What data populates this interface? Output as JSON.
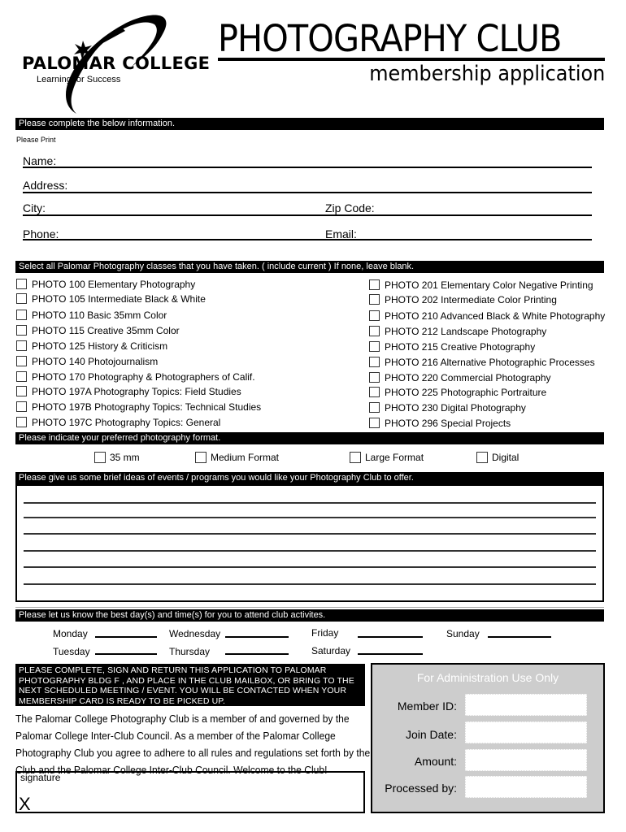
{
  "header": {
    "logo_name": "PALOMAR COLLEGE",
    "logo_tagline": "Learning for Success",
    "title": "PHOTOGRAPHY CLUB",
    "subtitle": "membership application"
  },
  "info_section": {
    "banner": "Please complete the below information.",
    "note": "Please Print",
    "fields": {
      "name": "Name:",
      "address": "Address:",
      "city": "City:",
      "zip": "Zip Code:",
      "phone": "Phone:",
      "email": "Email:"
    }
  },
  "classes_section": {
    "banner": "Select all Palomar Photography classes that you have taken. ( include current ) If none, leave blank.",
    "left": [
      {
        "label": "PHOTO 100 Elementary Photography",
        "checked": false
      },
      {
        "label": "PHOTO 105 Intermediate Black & White",
        "checked": false
      },
      {
        "label": "PHOTO 110 Basic 35mm Color",
        "checked": false
      },
      {
        "label": "PHOTO 115 Creative 35mm Color",
        "checked": false
      },
      {
        "label": "PHOTO 125 History & Criticism",
        "checked": false
      },
      {
        "label": "PHOTO 140 Photojournalism",
        "checked": false
      },
      {
        "label": "PHOTO 170 Photography & Photographers of Calif.",
        "checked": false
      },
      {
        "label": "PHOTO 197A Photography Topics: Field Studies",
        "checked": false
      },
      {
        "label": "PHOTO 197B Photography Topics: Technical Studies",
        "checked": false
      },
      {
        "label": "PHOTO 197C Photography Topics: General",
        "checked": false
      }
    ],
    "right": [
      {
        "label": "PHOTO 201 Elementary Color Negative Printing",
        "checked": false
      },
      {
        "label": "PHOTO 202 Intermediate Color Printing",
        "checked": false
      },
      {
        "label": "PHOTO 210 Advanced Black & White Photography",
        "checked": false
      },
      {
        "label": "PHOTO 212 Landscape Photography",
        "checked": false
      },
      {
        "label": "PHOTO 215 Creative Photography",
        "checked": false
      },
      {
        "label": "PHOTO 216  Alternative Photographic Processes",
        "checked": false
      },
      {
        "label": "PHOTO 220 Commercial Photography",
        "checked": false
      },
      {
        "label": "PHOTO 225 Photographic Portraiture",
        "checked": false
      },
      {
        "label": "PHOTO 230 Digital Photography",
        "checked": false
      },
      {
        "label": "PHOTO 296 Special Projects",
        "checked": false
      }
    ]
  },
  "format_section": {
    "banner": "Please indicate your preferred photography format.",
    "options": [
      "35 mm",
      "Medium Format",
      "Large Format",
      "Digital"
    ]
  },
  "ideas_section": {
    "banner": "Please give us some brief ideas of events / programs you would like your Photography Club to offer.",
    "value": ""
  },
  "days_section": {
    "banner": "Please let us know the best day(s) and time(s) for you to attend club activites.",
    "days": [
      "Monday",
      "Tuesday",
      "Wednesday",
      "Thursday",
      "Friday",
      "Saturday",
      "Sunday"
    ]
  },
  "return_notice": "PLEASE COMPLETE, SIGN AND RETURN THIS APPLICATION TO PALOMAR PHOTOGRAPHY  BLDG F , AND PLACE IN THE CLUB MAILBOX, OR BRING TO THE NEXT SCHEDULED MEETING / EVENT. YOU WILL BE CONTACTED WHEN YOUR MEMBERSHIP CARD IS READY TO BE PICKED UP.",
  "agreement": "The Palomar College Photography Club is a member of and governed by the Palomar College Inter-Club Council.  As a member of the Palomar College Photography Club you agree to adhere to all rules and regulations set forth by the Club and the Palomar College Inter-Club Council.  Welcome to the Club!",
  "signature": {
    "label": "signature",
    "mark": "X"
  },
  "admin": {
    "title": "For Administration Use Only",
    "fields": [
      "Member ID:",
      "Join Date:",
      "Amount:",
      "Processed by:"
    ]
  },
  "colors": {
    "banner_bg": "#000000",
    "admin_bg": "#cdcdcd"
  }
}
